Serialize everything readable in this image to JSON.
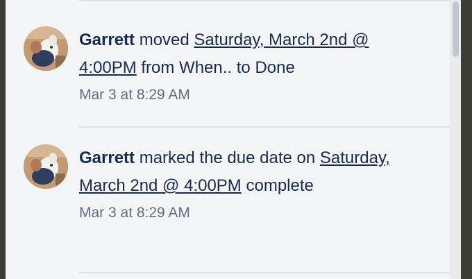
{
  "activity": [
    {
      "author": "Garrett",
      "action": "moved",
      "card_link": "Saturday, March 2nd @ 4:00PM",
      "after_link": "from When.. to Done",
      "timestamp": "Mar 3 at 8:29 AM",
      "avatar_icon": "user-avatar-photo"
    },
    {
      "author": "Garrett",
      "action": "marked the due date on",
      "card_link": "Saturday, March 2nd @ 4:00PM",
      "after_link": "complete",
      "timestamp": "Mar 3 at 8:29 AM",
      "avatar_icon": "user-avatar-photo"
    }
  ],
  "colors": {
    "panel_bg": "#f4f5f7",
    "text": "#172b4d",
    "timestamp": "#5e6c84",
    "divider": "#dfe1e6"
  }
}
